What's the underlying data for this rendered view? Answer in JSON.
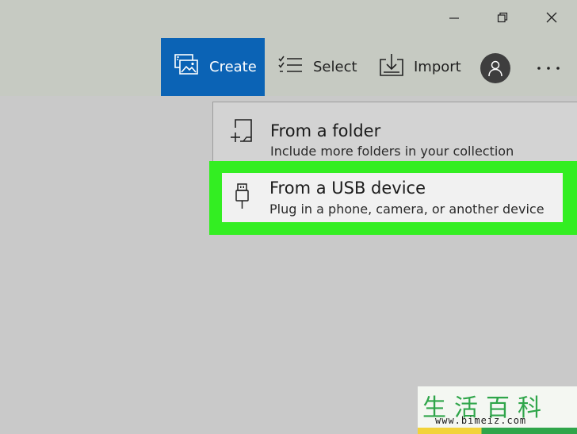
{
  "window_controls": {
    "minimize": "minimize-icon",
    "restore": "restore-icon",
    "close": "close-icon"
  },
  "toolbar": {
    "create_label": "Create",
    "select_label": "Select",
    "import_label": "Import",
    "accent_color": "#0b63b5"
  },
  "menu": {
    "items": [
      {
        "title": "From a folder",
        "subtitle": "Include more folders in your collection",
        "icon": "folder-add-icon"
      },
      {
        "title": "From a USB device",
        "subtitle": "Plug in a phone, camera, or another device",
        "icon": "usb-icon"
      }
    ],
    "highlight_color": "#33ee22"
  },
  "watermark": {
    "chars": "生活百科",
    "url": "www.bimeiz.com"
  }
}
